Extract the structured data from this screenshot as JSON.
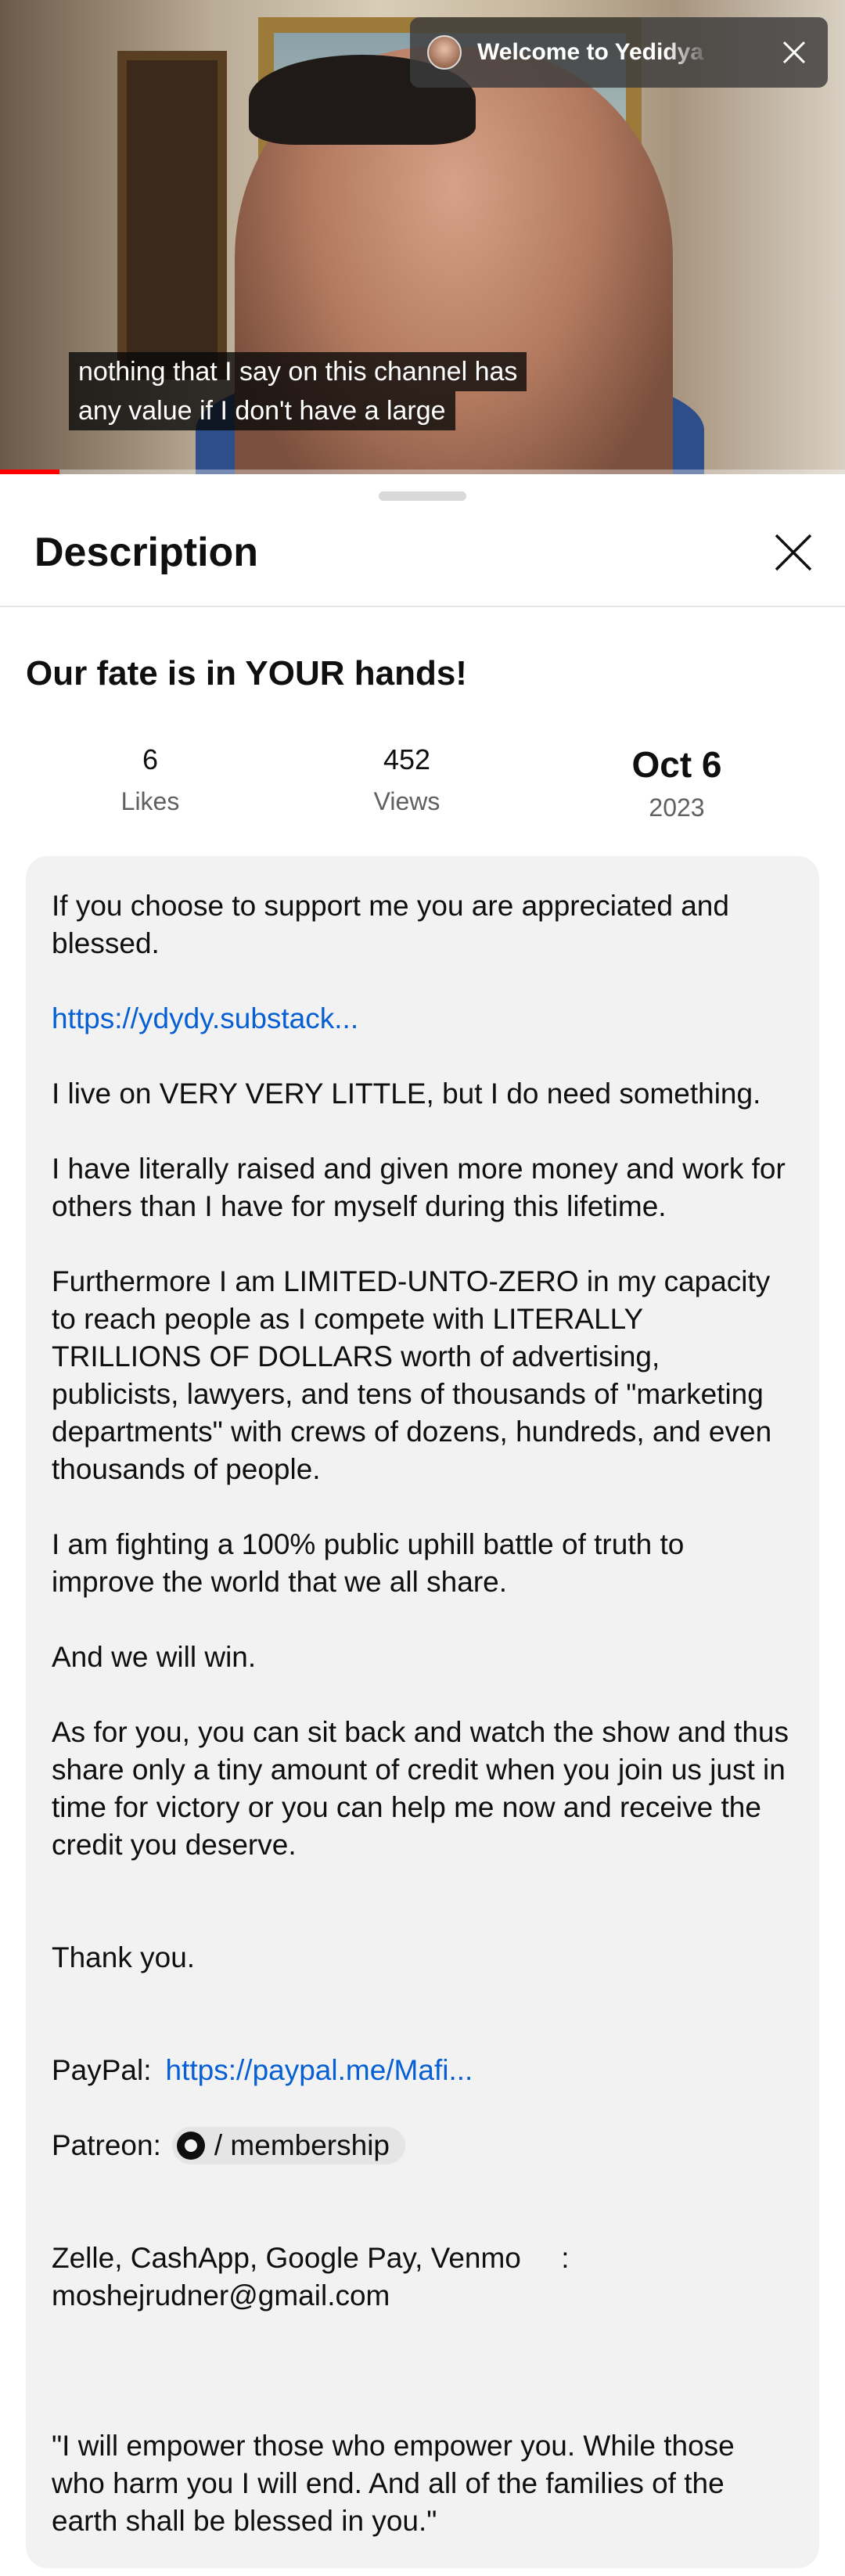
{
  "video": {
    "welcome_text": "Welcome to Yedidya",
    "caption_lines": [
      "nothing that I say on this channel has",
      "any value if I don't have a large"
    ],
    "progress_fraction": 0.07,
    "progress_color": "#ff0000"
  },
  "panel": {
    "header_title": "Description",
    "video_title": "Our fate is in YOUR hands!",
    "stats": {
      "likes_value": "6",
      "likes_label": "Likes",
      "views_value": "452",
      "views_label": "Views",
      "date_value": "Oct 6",
      "date_year": "2023"
    }
  },
  "description": {
    "p1": "If you choose to support me you are appreciated and blessed.",
    "link1": "https://ydydy.substack...",
    "p2": "I live on VERY VERY LITTLE, but I do need something.",
    "p3": "I have literally raised and given more money and work for others than I have for myself during this lifetime.",
    "p4": "Furthermore I am LIMITED-UNTO-ZERO in my capacity to reach people as I compete with LITERALLY TRILLIONS OF DOLLARS worth of advertising, publicists, lawyers, and tens of thousands of \"marketing departments\" with crews of dozens, hundreds, and even thousands of people.",
    "p5": "I am fighting a 100% public uphill battle of truth to improve the world that we all share.",
    "p6": "And we will win.",
    "p7": "As for you, you can sit back and watch the show and thus share only a tiny amount of credit when you join us just in time for victory or you can help me now and receive the credit you deserve.",
    "p8": "Thank you.",
    "paypal_label": "PayPal:",
    "paypal_link": "https://paypal.me/Mafi...",
    "patreon_label": "Patreon:",
    "patreon_chip": "/ membership",
    "zelle_line": "Zelle, CashApp, Google Pay, Venmo     :",
    "email": "moshejrudner@gmail.com",
    "quote": "\"I will empower those who empower you. While those who harm you I will end. And all of the families of the earth shall be blessed in you.\""
  },
  "colors": {
    "link": "#065fd4",
    "box_background": "#f2f2f2"
  }
}
